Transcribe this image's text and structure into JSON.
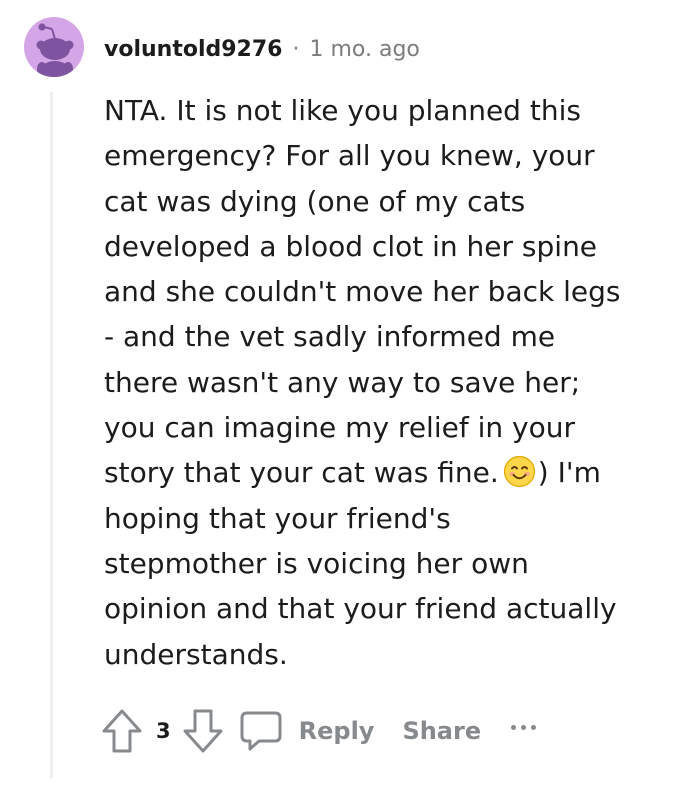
{
  "comment": {
    "username": "voluntold9276",
    "separator": "·",
    "timestamp": "1 mo. ago",
    "body_lines": [
      "NTA. It is not like you planned this",
      "emergency? For all you knew, your",
      "cat was dying (one of my cats",
      "developed a blood clot in her spine",
      "and she couldn't move her back legs",
      "- and the vet sadly informed me",
      "there wasn't any way to save her;",
      "you can imagine my relief in your",
      "story that your cat was fine.",
      ") I'm",
      "hoping that your friend's",
      "stepmother is voicing her own",
      "opinion and that your friend actually",
      "understands."
    ],
    "emoji": "smiling-face-emoji"
  },
  "actions": {
    "upvote_icon": "upvote-arrow-icon",
    "vote_count": "3",
    "downvote_icon": "downvote-arrow-icon",
    "reply_icon": "speech-bubble-icon",
    "reply_label": "Reply",
    "share_label": "Share",
    "more_icon": "more-options-icon"
  },
  "colors": {
    "avatar_bg": "#d4a6e8",
    "avatar_snoo": "#7e53a0",
    "text": "#1c1c1c",
    "meta": "#7c7c7c",
    "action": "#878a8c",
    "thread_line": "#edeff1",
    "emoji_face": "#ffd54a"
  }
}
